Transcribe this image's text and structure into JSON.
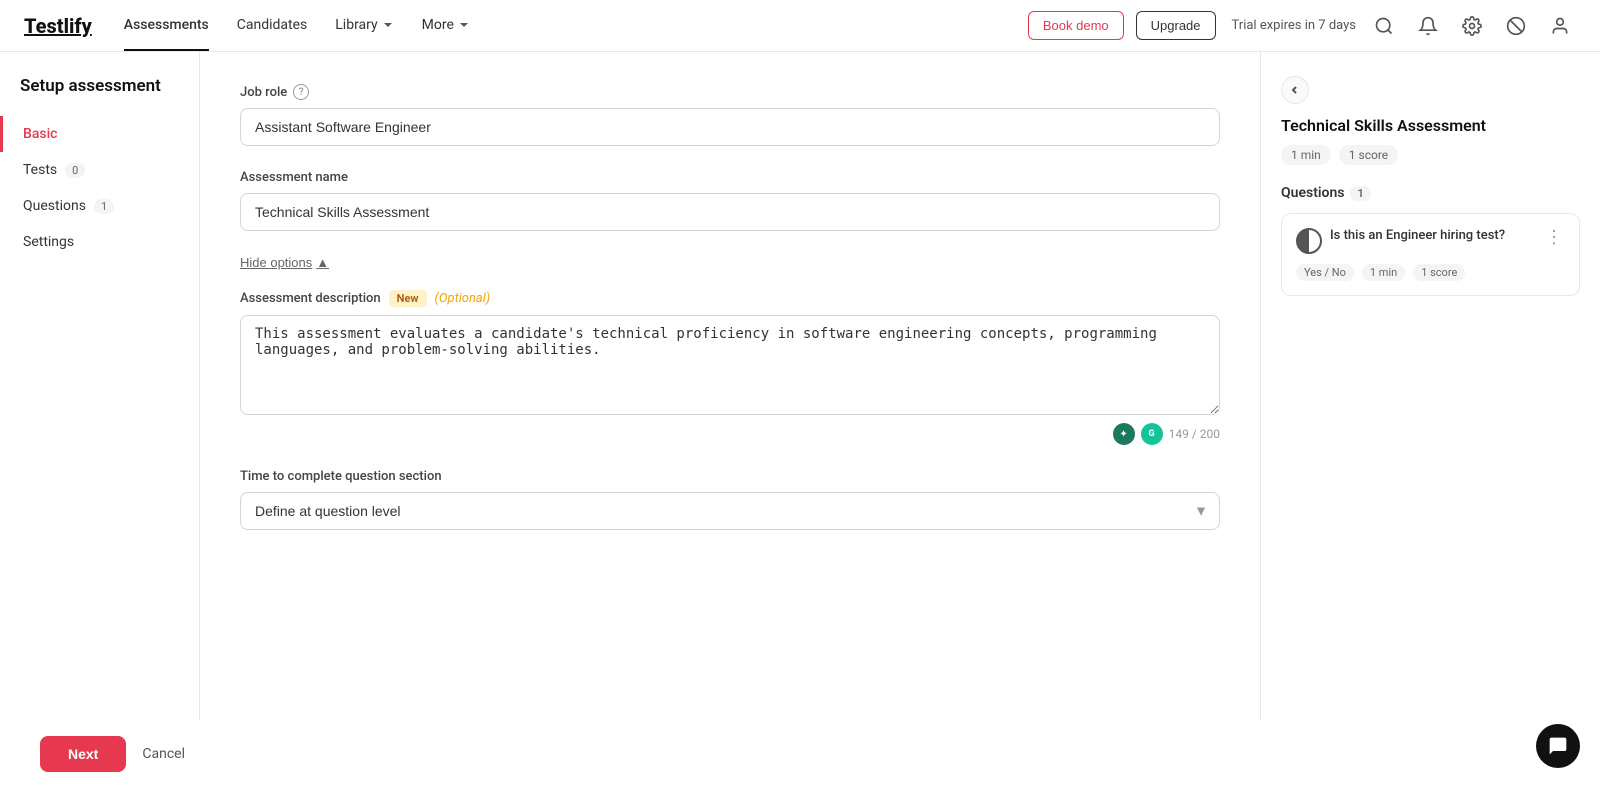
{
  "app": {
    "logo": "Testlify"
  },
  "nav": {
    "links": [
      {
        "id": "assessments",
        "label": "Assessments",
        "active": true,
        "has_chevron": false
      },
      {
        "id": "candidates",
        "label": "Candidates",
        "active": false,
        "has_chevron": false
      },
      {
        "id": "library",
        "label": "Library",
        "active": false,
        "has_chevron": true
      },
      {
        "id": "more",
        "label": "More",
        "active": false,
        "has_chevron": true
      }
    ],
    "book_demo": "Book demo",
    "upgrade": "Upgrade",
    "trial": "Trial expires in 7 days"
  },
  "sidebar": {
    "title": "Setup assessment",
    "items": [
      {
        "id": "basic",
        "label": "Basic",
        "active": true,
        "badge": null
      },
      {
        "id": "tests",
        "label": "Tests",
        "active": false,
        "badge": "0"
      },
      {
        "id": "questions",
        "label": "Questions",
        "active": false,
        "badge": "1"
      },
      {
        "id": "settings",
        "label": "Settings",
        "active": false,
        "badge": null
      }
    ]
  },
  "form": {
    "job_role_label": "Job role",
    "job_role_value": "Assistant Software Engineer",
    "assessment_name_label": "Assessment name",
    "assessment_name_value": "Technical Skills Assessment",
    "hide_options": "Hide options",
    "assessment_desc_label": "Assessment description",
    "badge_new": "New",
    "optional": "(Optional)",
    "desc_value": "This assessment evaluates a candidate's technical proficiency in software engineering concepts, programming languages, and problem-solving abilities.",
    "char_count": "149 / 200",
    "time_label": "Time to complete question section",
    "time_placeholder": "Define at question level",
    "next_btn": "Next",
    "cancel_btn": "Cancel"
  },
  "right_panel": {
    "title": "Technical Skills Assessment",
    "badge_min": "1 min",
    "badge_score": "1 score",
    "questions_label": "Questions",
    "questions_count": "1",
    "question": {
      "text": "Is this an Engineer hiring test?",
      "meta_yes_no": "Yes / No",
      "meta_min": "1 min",
      "meta_score": "1 score"
    }
  }
}
